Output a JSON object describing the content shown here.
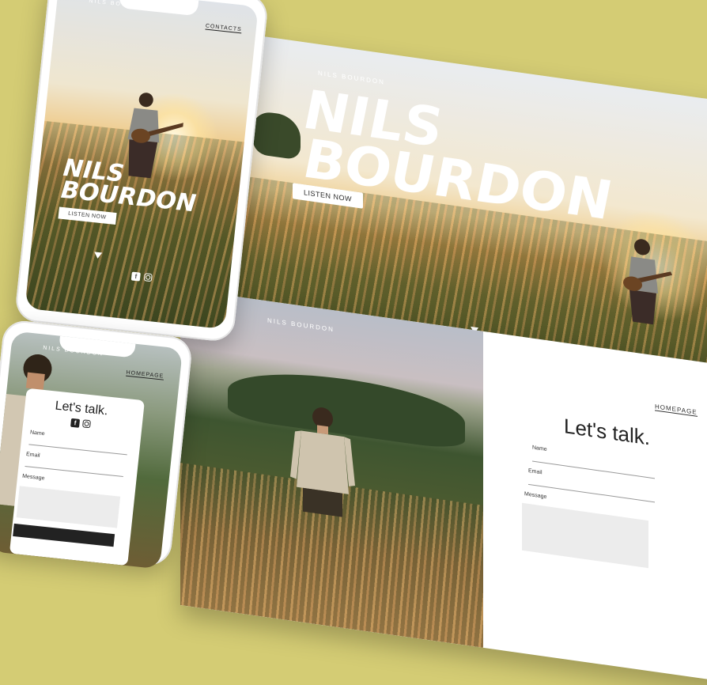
{
  "artist": {
    "logo": "NILS BOURDON",
    "title_line1": "NILS",
    "title_line2": "BOURDON",
    "listen_button": "LISTEN NOW"
  },
  "nav": {
    "contacts": "CONTACTS",
    "homepage": "HOMEPAGE"
  },
  "contact_form": {
    "heading": "Let's talk.",
    "name_label": "Name",
    "email_label": "Email",
    "message_label": "Message"
  },
  "social": {
    "facebook_glyph": "f",
    "icons": [
      "facebook-icon",
      "instagram-icon"
    ]
  },
  "colors": {
    "background": "#d4cc74",
    "text_light": "#ffffff",
    "text_dark": "#222222"
  }
}
